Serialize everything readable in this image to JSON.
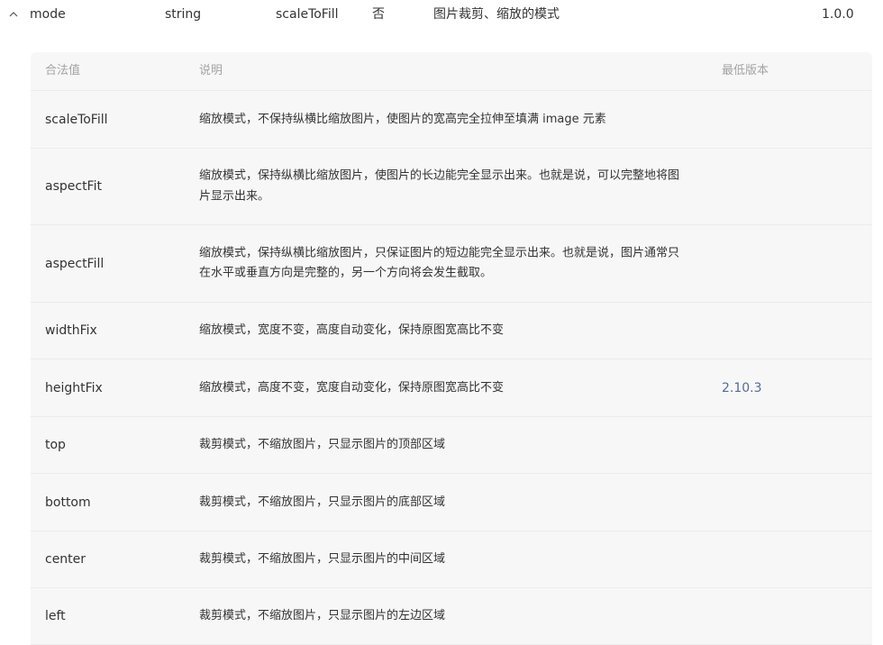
{
  "prop": {
    "name": "mode",
    "type": "string",
    "default": "scaleToFill",
    "required": "否",
    "desc": "图片裁剪、缩放的模式",
    "version": "1.0.0"
  },
  "table": {
    "headers": {
      "value": "合法值",
      "desc": "说明",
      "version": "最低版本"
    },
    "rows": [
      {
        "name": "scaleToFill",
        "desc": "缩放模式，不保持纵横比缩放图片，使图片的宽高完全拉伸至填满 image 元素",
        "version": ""
      },
      {
        "name": "aspectFit",
        "desc": "缩放模式，保持纵横比缩放图片，使图片的长边能完全显示出来。也就是说，可以完整地将图片显示出来。",
        "version": ""
      },
      {
        "name": "aspectFill",
        "desc": "缩放模式，保持纵横比缩放图片，只保证图片的短边能完全显示出来。也就是说，图片通常只在水平或垂直方向是完整的，另一个方向将会发生截取。",
        "version": ""
      },
      {
        "name": "widthFix",
        "desc": "缩放模式，宽度不变，高度自动变化，保持原图宽高比不变",
        "version": ""
      },
      {
        "name": "heightFix",
        "desc": "缩放模式，高度不变，宽度自动变化，保持原图宽高比不变",
        "version": "2.10.3"
      },
      {
        "name": "top",
        "desc": "裁剪模式，不缩放图片，只显示图片的顶部区域",
        "version": ""
      },
      {
        "name": "bottom",
        "desc": "裁剪模式，不缩放图片，只显示图片的底部区域",
        "version": ""
      },
      {
        "name": "center",
        "desc": "裁剪模式，不缩放图片，只显示图片的中间区域",
        "version": ""
      },
      {
        "name": "left",
        "desc": "裁剪模式，不缩放图片，只显示图片的左边区域",
        "version": ""
      }
    ]
  },
  "icons": {
    "collapse": "chevron-up-icon"
  },
  "colors": {
    "panel_bg": "#f7f7f7",
    "header_text": "#a3a3a3",
    "version_link": "#576b95",
    "divider": "#ececec"
  }
}
